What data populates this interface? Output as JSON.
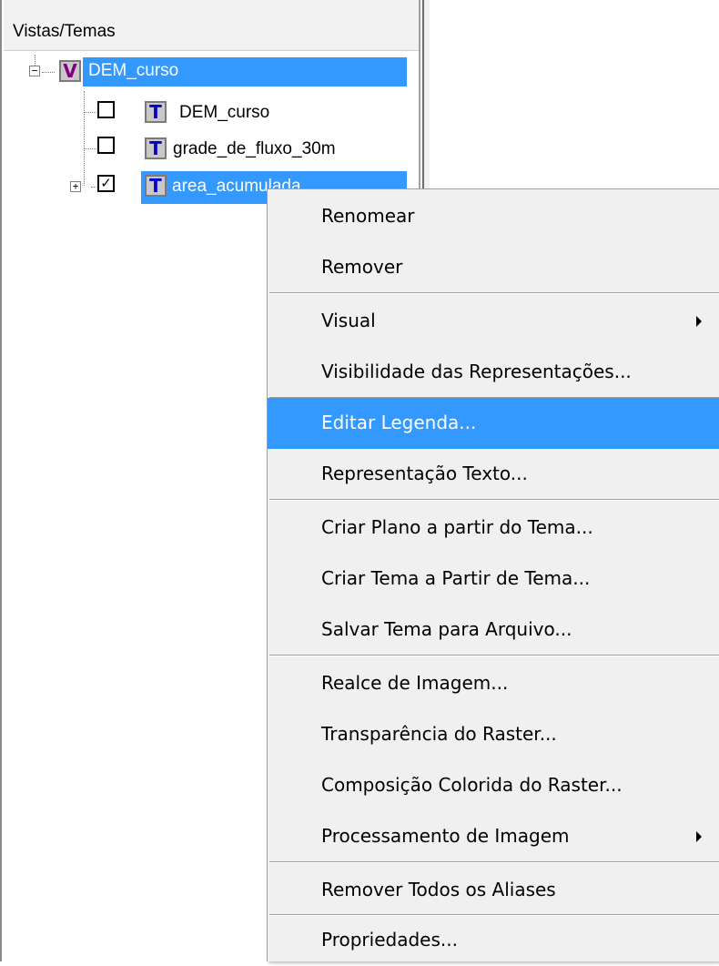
{
  "panel": {
    "header_title": "Vistas/Temas"
  },
  "tree": {
    "view": {
      "label": "DEM_curso",
      "icon": "V"
    },
    "themes": [
      {
        "label": "DEM_curso",
        "icon": "T",
        "checked": false
      },
      {
        "label": "grade_de_fluxo_30m",
        "icon": "T",
        "checked": false
      },
      {
        "label": "area_acumulada",
        "icon": "T",
        "checked": true
      }
    ],
    "expander_minus": "−",
    "expander_plus": "+",
    "check_mark": "✓"
  },
  "context_menu": {
    "items": [
      {
        "label": "Renomear"
      },
      {
        "label": "Remover"
      },
      {
        "label": "Visual",
        "submenu": true
      },
      {
        "label": "Visibilidade das Representações..."
      },
      {
        "label": "Editar Legenda...",
        "highlighted": true
      },
      {
        "label": "Representação Texto..."
      },
      {
        "label": "Criar Plano a partir do Tema..."
      },
      {
        "label": "Criar Tema a Partir de Tema..."
      },
      {
        "label": "Salvar Tema para Arquivo..."
      },
      {
        "label": "Realce de Imagem..."
      },
      {
        "label": "Transparência do Raster..."
      },
      {
        "label": "Composição Colorida do Raster..."
      },
      {
        "label": "Processamento de Imagem",
        "submenu": true
      },
      {
        "label": "Remover Todos os Aliases"
      },
      {
        "label": "Propriedades..."
      }
    ]
  },
  "colors": {
    "selection": "#3399ff",
    "view_icon": "#800080",
    "theme_icon": "#0000d0"
  }
}
